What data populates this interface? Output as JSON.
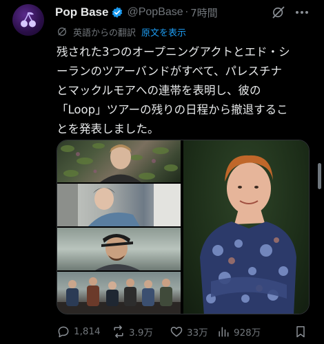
{
  "tweet": {
    "author_name": "Pop Base",
    "handle": "@PopBase",
    "separator": "·",
    "time": "7時間",
    "translation_label": "英語からの翻訳",
    "show_original": "原文を表示",
    "text_lines": [
      "残された3つのオープニングアクトとエド・シ",
      "ーランのツアーバンドがすべて、パレスチナ",
      "とマックルモアへの連帯を表明し、彼の",
      "「Loop」ツアーの残りの日程から撤退するこ",
      "とを発表しました。"
    ],
    "media": {
      "panels": [
        "man-with-leaves-photo",
        "man-in-blue-shirt-photo",
        "man-with-cap-photo",
        "band-group-photo",
        "ed-sheeran-photo"
      ]
    }
  },
  "actions": {
    "replies": "1,814",
    "reposts": "3.9万",
    "likes": "33万",
    "views": "928万"
  },
  "colors": {
    "background": "#000000",
    "text": "#e7e9ea",
    "muted": "#71767b",
    "link": "#1d9bf0",
    "verified": "#1d9bf0"
  },
  "icons": [
    "avatar-cherry-icon",
    "verified-badge-icon",
    "grok-icon",
    "more-icon",
    "translate-icon",
    "reply-icon",
    "repost-icon",
    "like-icon",
    "views-icon",
    "bookmark-icon"
  ]
}
